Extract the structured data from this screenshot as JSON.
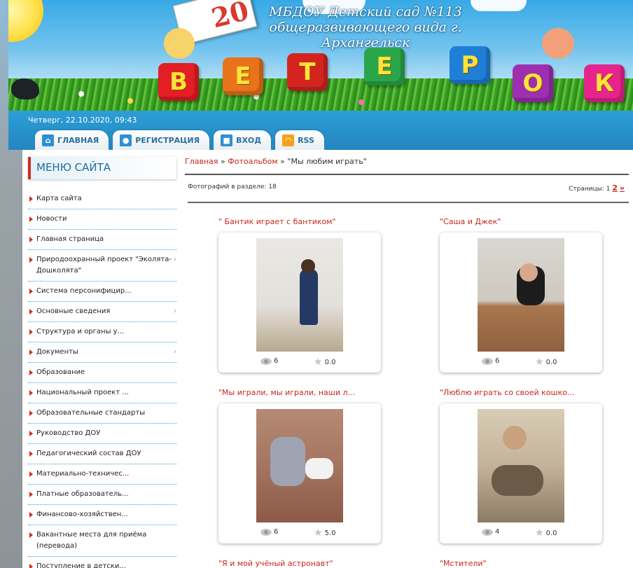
{
  "header": {
    "site_title_line1": "МБДОУ Детский сад №113",
    "site_title_line2": "общеразвивающего вида г. Архангельск",
    "calendar_number": "20",
    "blocks": [
      "В",
      "Е",
      "Т",
      "Е",
      "Р",
      "О",
      "К"
    ]
  },
  "topbar": {
    "date": "Четверг, 22.10.2020, 09:43",
    "tabs": [
      {
        "label": "ГЛАВНАЯ",
        "icon": "home-icon"
      },
      {
        "label": "РЕГИСТРАЦИЯ",
        "icon": "user-icon"
      },
      {
        "label": "ВХОД",
        "icon": "lock-icon"
      },
      {
        "label": "RSS",
        "icon": "rss-icon"
      }
    ]
  },
  "sidebar": {
    "heading": "МЕНЮ САЙТА",
    "items": [
      {
        "label": "Карта сайта"
      },
      {
        "label": "Новости"
      },
      {
        "label": "Главная страница"
      },
      {
        "label": "Природоохранный проект \"Эколята-Дошколята\"",
        "has_sub": true
      },
      {
        "label": "Система персонифицир..."
      },
      {
        "label": "Основные сведения",
        "has_sub": true
      },
      {
        "label": "Структура и органы у..."
      },
      {
        "label": "Документы",
        "has_sub": true
      },
      {
        "label": "Образование"
      },
      {
        "label": "Национальный проект ..."
      },
      {
        "label": "Образовательные стандарты"
      },
      {
        "label": "Руководство ДОУ"
      },
      {
        "label": "Педагогический состав ДОУ"
      },
      {
        "label": "Материально-техничес..."
      },
      {
        "label": "Платные образователь..."
      },
      {
        "label": "Финансово-хозяйствен..."
      },
      {
        "label": "Вакантные места для приёма (перевода)"
      },
      {
        "label": "Поступление в детски..."
      }
    ],
    "submenu_arrow": "›"
  },
  "breadcrumb": {
    "home": "Главная",
    "sep1": " » ",
    "albums": "Фотоальбом",
    "sep2": " » ",
    "current": "\"Мы любим играть\""
  },
  "album_info": {
    "count_label": "Фотографий в разделе: 18",
    "pages_label": "Страницы:",
    "page_current": "1",
    "page_next": "2",
    "page_next_arrow": "»"
  },
  "photos": [
    {
      "title": "\" Бантик играет с бантиком\"",
      "views": "6",
      "rating": "0.0"
    },
    {
      "title": "\"Саша и Джек\"",
      "views": "6",
      "rating": "0.0"
    },
    {
      "title": "\"Мы играли, мы играли, наши л...",
      "views": "6",
      "rating": "5.0"
    },
    {
      "title": "\"Люблю играть со своей кошко...",
      "views": "4",
      "rating": "0.0"
    },
    {
      "title": "\"Я и мой учёный астронавт\"",
      "views": "",
      "rating": ""
    },
    {
      "title": "\"Мстители\"",
      "views": "",
      "rating": ""
    }
  ],
  "colors": {
    "accent_red": "#c7261c",
    "bar_blue": "#2486bf",
    "tab_text": "#2a6f9f"
  }
}
